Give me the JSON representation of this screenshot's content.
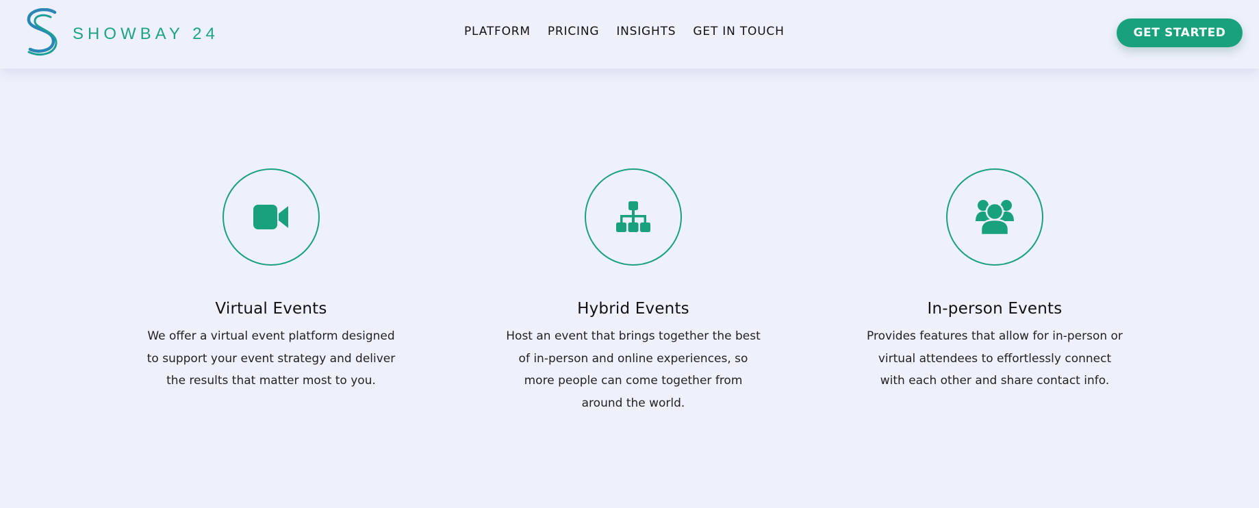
{
  "header": {
    "logo_text": "SHOWBAY 24",
    "nav": [
      {
        "label": "PLATFORM"
      },
      {
        "label": "PRICING"
      },
      {
        "label": "INSIGHTS"
      },
      {
        "label": "GET IN TOUCH"
      }
    ],
    "cta_label": "GET STARTED"
  },
  "features": [
    {
      "icon": "video-camera-icon",
      "title": "Virtual Events",
      "description": "We offer a virtual event platform designed to support your event strategy and deliver the results that matter most to you."
    },
    {
      "icon": "sitemap-icon",
      "title": "Hybrid Events",
      "description": "Host an event that brings together the best of in-person and online experiences, so more people can come together from around the world."
    },
    {
      "icon": "users-icon",
      "title": "In-person Events",
      "description": "Provides features that allow for in-person or virtual attendees to effortlessly connect with each other and share contact info."
    }
  ],
  "colors": {
    "accent": "#18a17c",
    "background": "#eef1fc",
    "logo_blue": "#1e7fa8"
  }
}
